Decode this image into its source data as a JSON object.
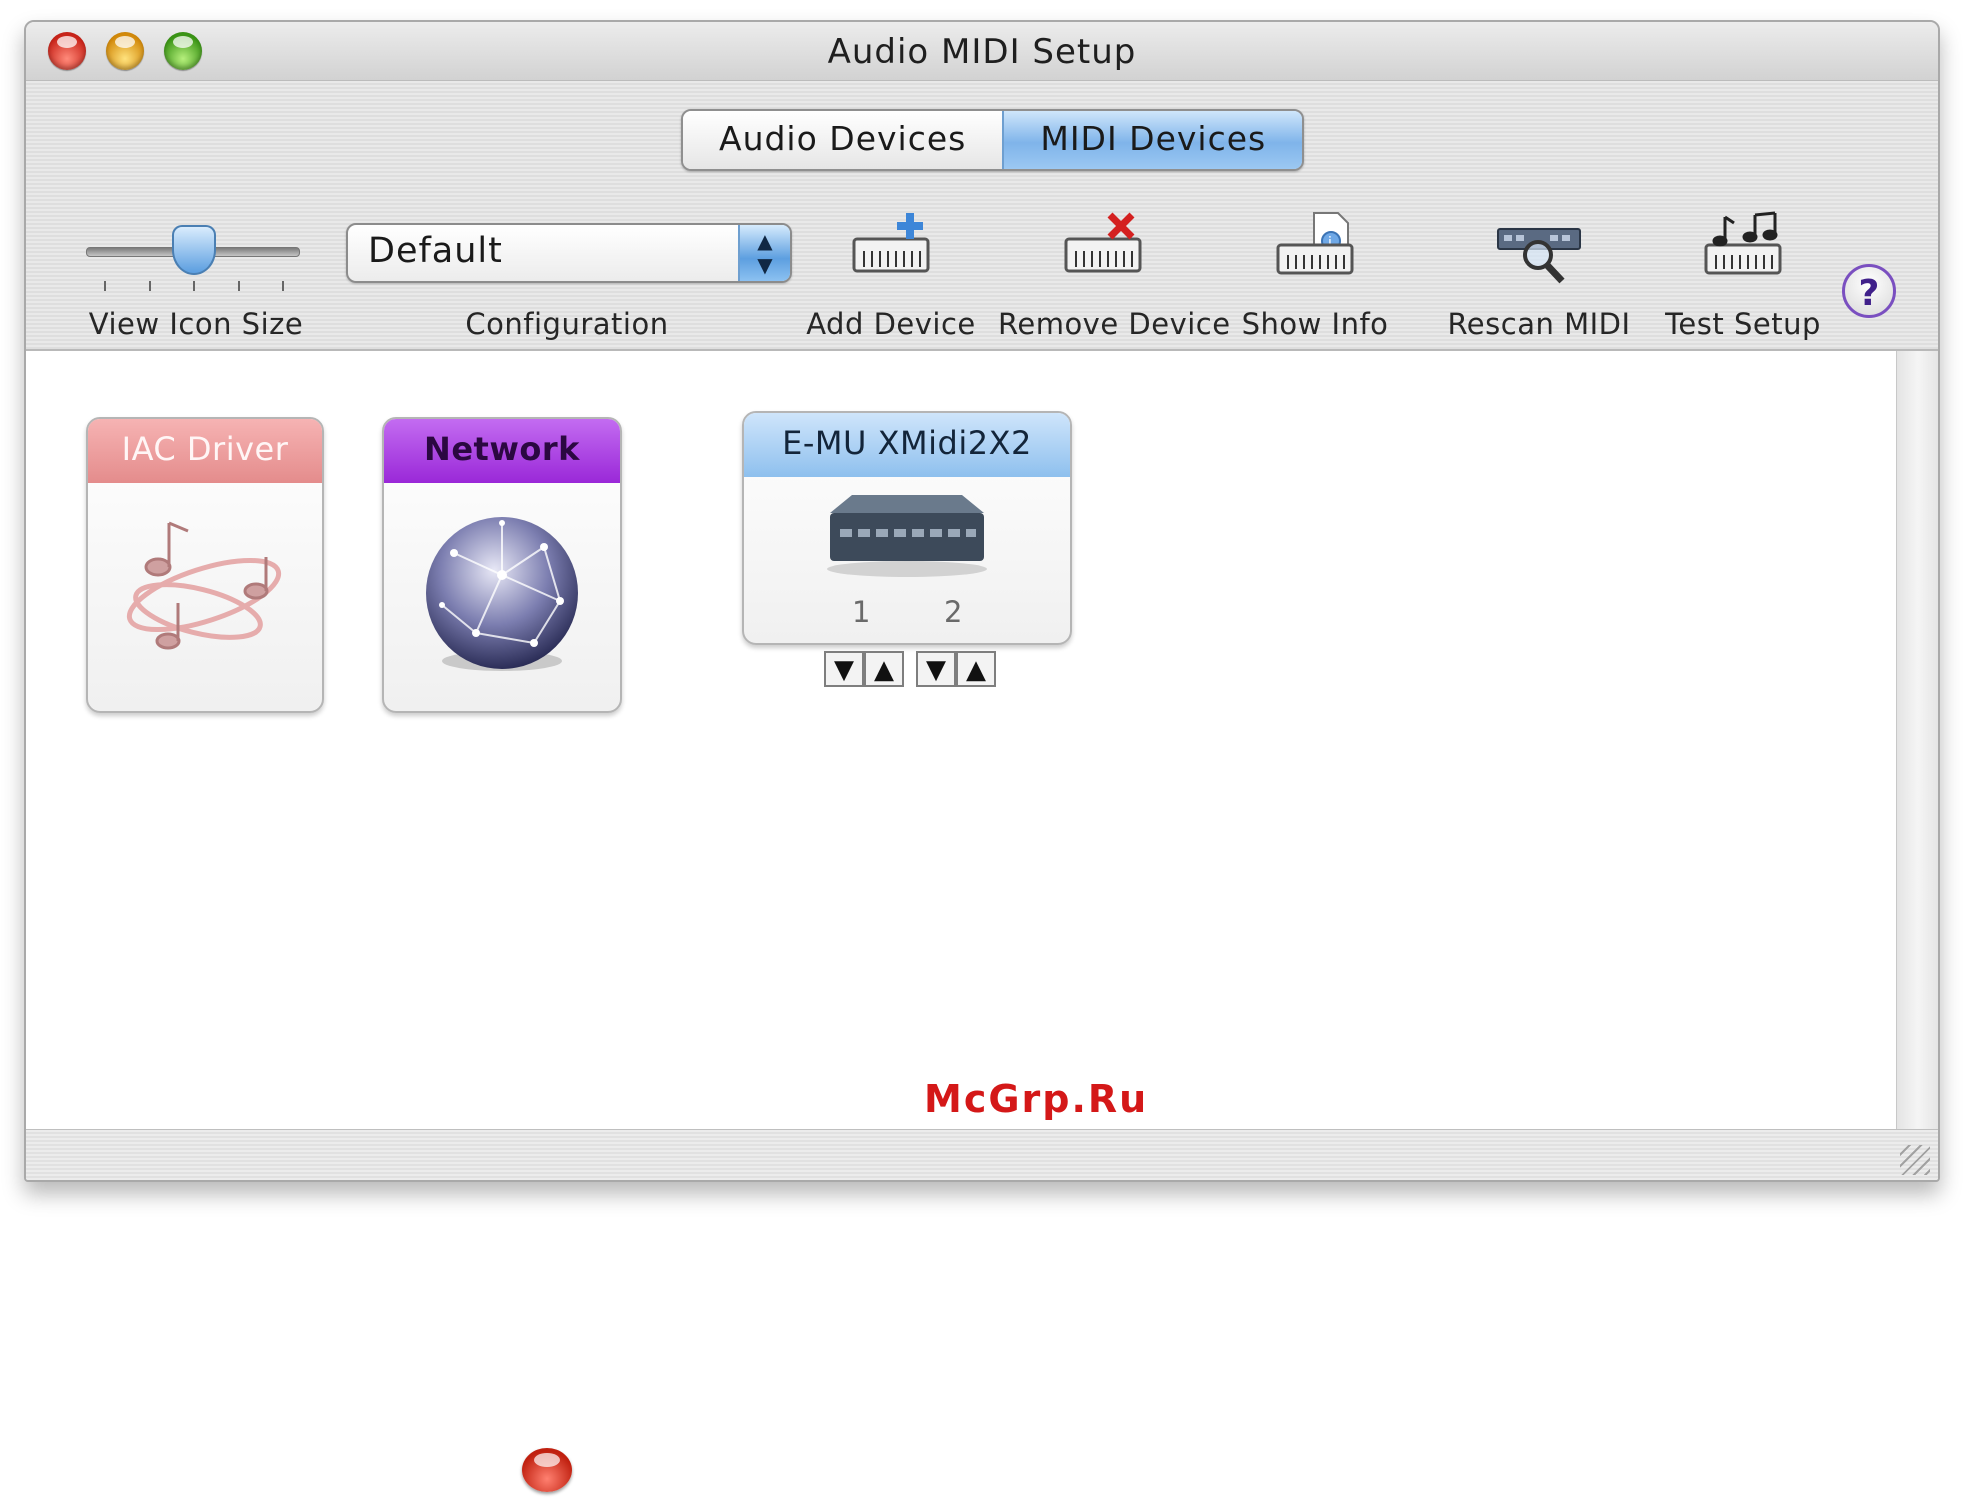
{
  "window": {
    "title": "Audio MIDI Setup"
  },
  "tabs": [
    {
      "label": "Audio Devices",
      "active": false
    },
    {
      "label": "MIDI Devices",
      "active": true
    }
  ],
  "toolbar": {
    "icon_size_label": "View Icon Size",
    "configuration_label": "Configuration",
    "configuration_value": "Default",
    "add_device": "Add Device",
    "remove_device": "Remove Device",
    "show_info": "Show Info",
    "rescan_midi": "Rescan MIDI",
    "test_setup": "Test Setup",
    "help": "?"
  },
  "devices": [
    {
      "name": "IAC Driver",
      "icon": "music-notes-icon",
      "color": "#e48c8c",
      "active": false
    },
    {
      "name": "Network",
      "icon": "network-globe-icon",
      "color": "#9a28d8",
      "active": true
    },
    {
      "name": "E-MU XMidi2X2",
      "icon": "midi-interface-icon",
      "color": "#8ec0ee",
      "active": true,
      "ports": [
        "1",
        "2"
      ]
    }
  ],
  "watermark": "McGrp.Ru"
}
